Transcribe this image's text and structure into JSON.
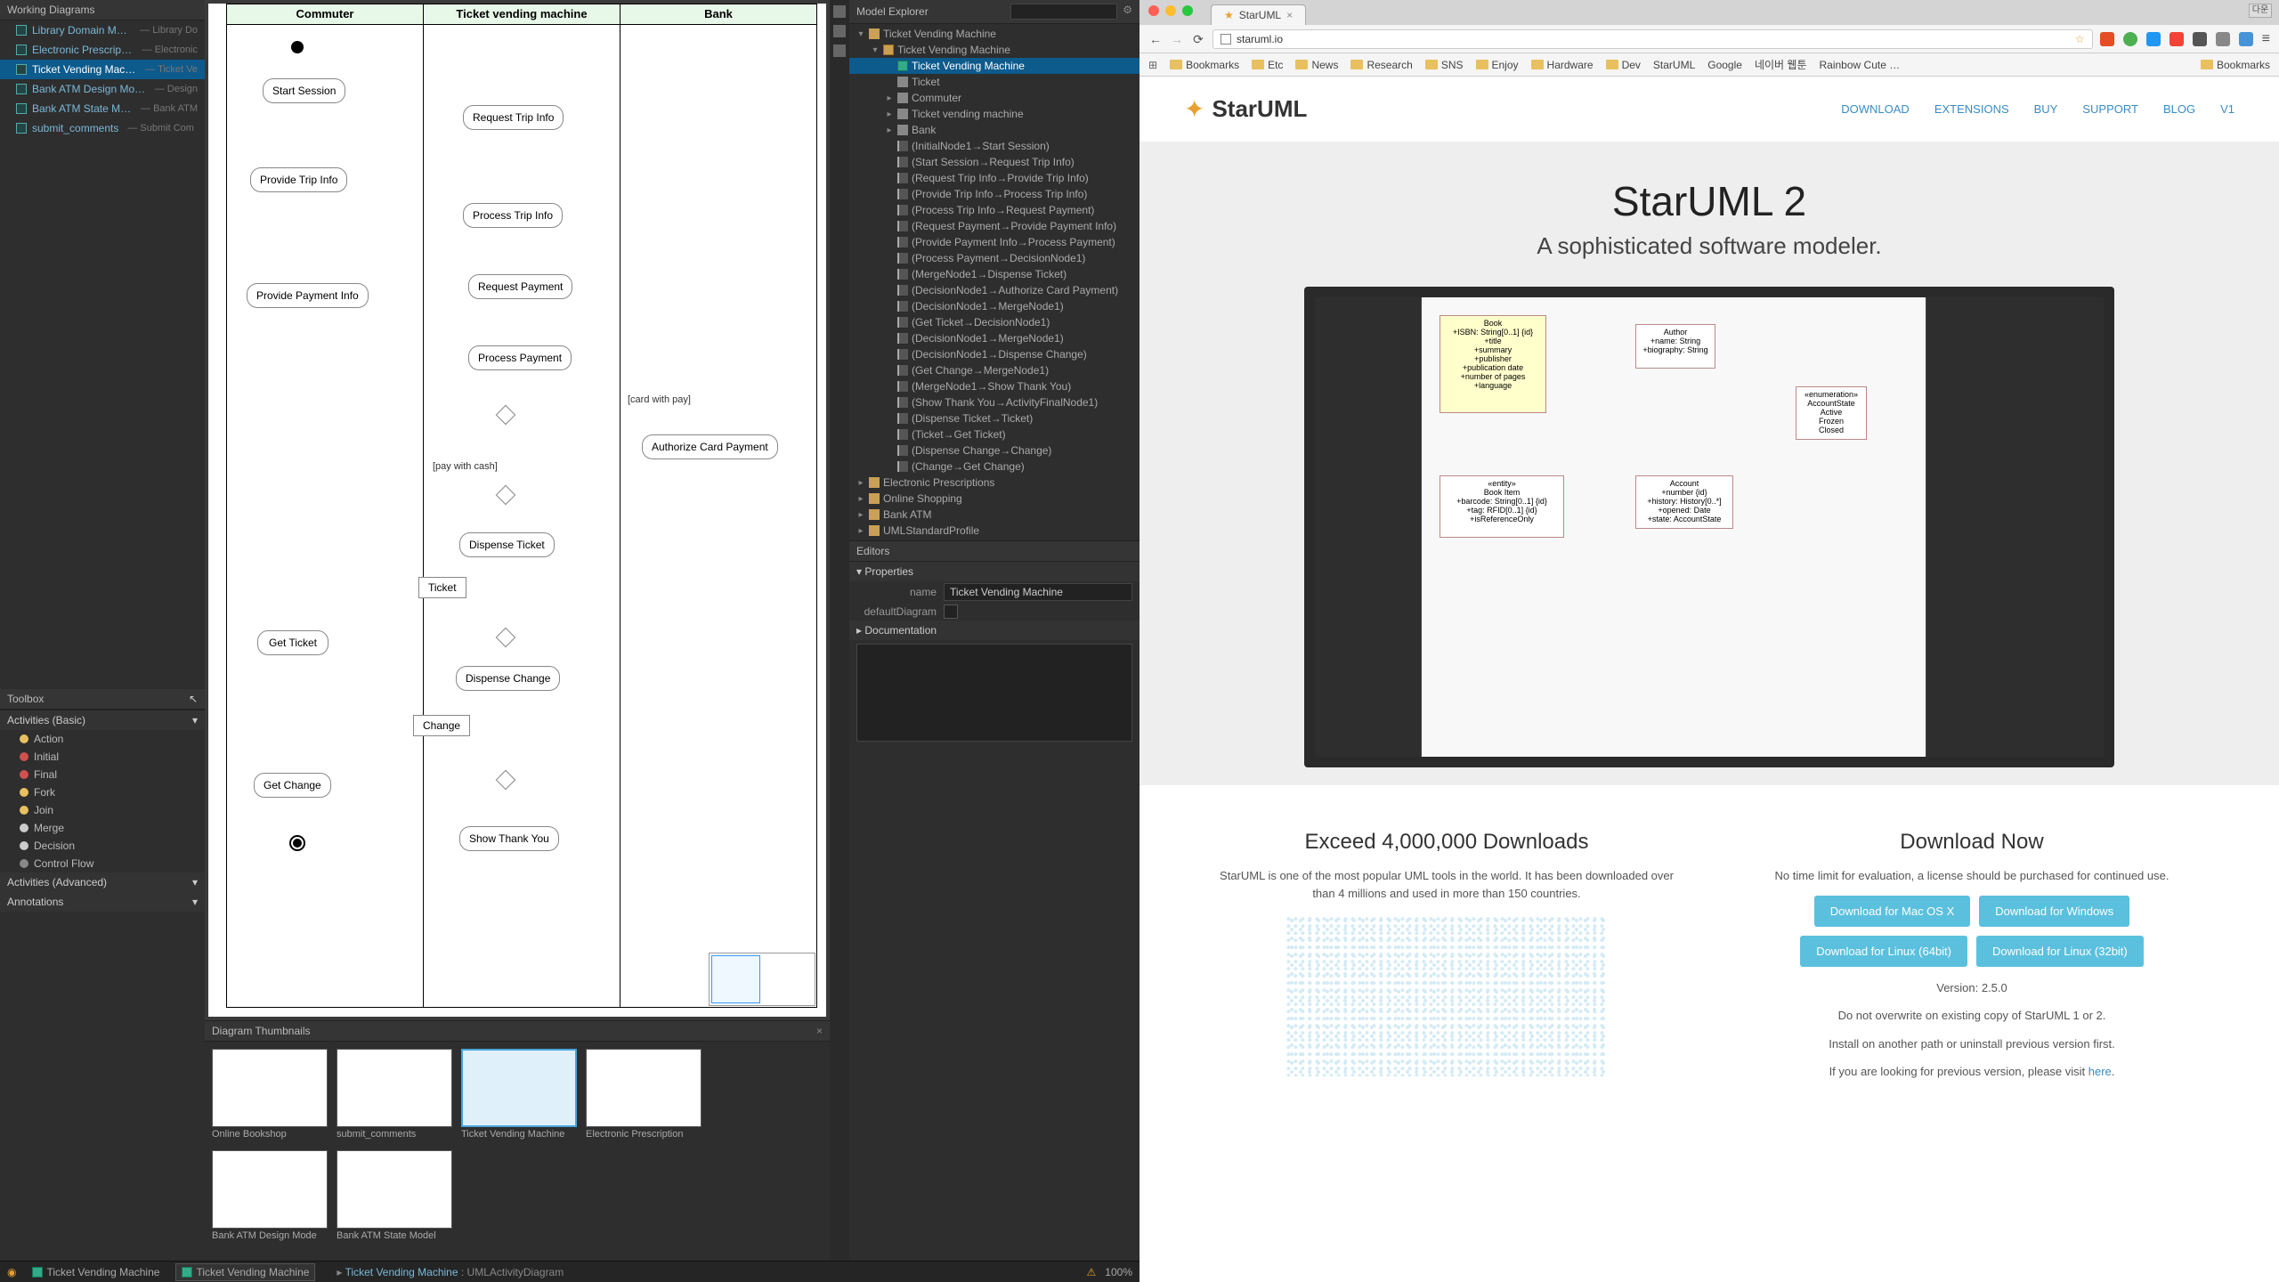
{
  "leftApp": {
    "workingDiagrams": {
      "title": "Working Diagrams",
      "items": [
        {
          "name": "Library Domain Model",
          "sub": "— Library Do"
        },
        {
          "name": "Electronic Prescriptions",
          "sub": "— Electronic"
        },
        {
          "name": "Ticket Vending Machine",
          "sub": "— Ticket Ve",
          "selected": true
        },
        {
          "name": "Bank ATM Design Model",
          "sub": "— Design"
        },
        {
          "name": "Bank ATM State Model",
          "sub": "— Bank ATM"
        },
        {
          "name": "submit_comments",
          "sub": "— Submit Com"
        }
      ]
    },
    "toolbox": {
      "title": "Toolbox",
      "cursor": "↖",
      "sections": [
        {
          "name": "Activities (Basic)",
          "items": [
            {
              "label": "Action",
              "color": "#e8c060"
            },
            {
              "label": "Initial",
              "color": "#d05050"
            },
            {
              "label": "Final",
              "color": "#d05050"
            },
            {
              "label": "Fork",
              "color": "#e8c060"
            },
            {
              "label": "Join",
              "color": "#e8c060"
            },
            {
              "label": "Merge",
              "color": "#ccc"
            },
            {
              "label": "Decision",
              "color": "#ccc"
            },
            {
              "label": "Control Flow",
              "color": "#888"
            }
          ]
        },
        {
          "name": "Activities (Advanced)",
          "items": []
        },
        {
          "name": "Annotations",
          "items": []
        }
      ]
    },
    "canvas": {
      "swimlanes": [
        "Commuter",
        "Ticket vending machine",
        "Bank"
      ],
      "nodes": {
        "start_session": "Start Session",
        "request_trip_info": "Request Trip Info",
        "provide_trip_info": "Provide Trip Info",
        "process_trip_info": "Process Trip Info",
        "provide_payment_info": "Provide Payment Info",
        "request_payment": "Request Payment",
        "process_payment": "Process Payment",
        "authorize_card": "Authorize Card Payment",
        "dispense_ticket": "Dispense Ticket",
        "ticket": "Ticket",
        "get_ticket": "Get Ticket",
        "dispense_change": "Dispense Change",
        "change": "Change",
        "get_change": "Get Change",
        "show_thank_you": "Show Thank You"
      },
      "guards": {
        "pay_cash": "[pay with cash]",
        "card_pay": "[card with pay]"
      }
    },
    "thumbnails": {
      "title": "Diagram Thumbnails",
      "items": [
        {
          "label": "Online Bookshop"
        },
        {
          "label": "submit_comments"
        },
        {
          "label": "Ticket Vending Machine",
          "selected": true
        },
        {
          "label": "Electronic Prescription"
        },
        {
          "label": "Bank ATM Design Mode"
        },
        {
          "label": "Bank ATM State Model"
        }
      ]
    },
    "modelExplorer": {
      "title": "Model Explorer",
      "searchPlaceholder": "",
      "tree": [
        {
          "d": 0,
          "t": "▾",
          "ico": "pkg",
          "label": "Ticket Vending Machine"
        },
        {
          "d": 1,
          "t": "▾",
          "ico": "model",
          "label": "Ticket Vending Machine"
        },
        {
          "d": 2,
          "t": "",
          "ico": "diag",
          "label": "Ticket Vending Machine",
          "selected": true
        },
        {
          "d": 2,
          "t": "",
          "ico": "part",
          "label": "Ticket"
        },
        {
          "d": 2,
          "t": "▸",
          "ico": "part",
          "label": "Commuter"
        },
        {
          "d": 2,
          "t": "▸",
          "ico": "part",
          "label": "Ticket vending machine"
        },
        {
          "d": 2,
          "t": "▸",
          "ico": "part",
          "label": "Bank"
        },
        {
          "d": 2,
          "t": "",
          "ico": "flow",
          "label": "(InitialNode1→Start Session)"
        },
        {
          "d": 2,
          "t": "",
          "ico": "flow",
          "label": "(Start Session→Request Trip Info)"
        },
        {
          "d": 2,
          "t": "",
          "ico": "flow",
          "label": "(Request Trip Info→Provide Trip Info)"
        },
        {
          "d": 2,
          "t": "",
          "ico": "flow",
          "label": "(Provide Trip Info→Process Trip Info)"
        },
        {
          "d": 2,
          "t": "",
          "ico": "flow",
          "label": "(Process Trip Info→Request Payment)"
        },
        {
          "d": 2,
          "t": "",
          "ico": "flow",
          "label": "(Request Payment→Provide Payment Info)"
        },
        {
          "d": 2,
          "t": "",
          "ico": "flow",
          "label": "(Provide Payment Info→Process Payment)"
        },
        {
          "d": 2,
          "t": "",
          "ico": "flow",
          "label": "(Process Payment→DecisionNode1)"
        },
        {
          "d": 2,
          "t": "",
          "ico": "flow",
          "label": "(MergeNode1→Dispense Ticket)"
        },
        {
          "d": 2,
          "t": "",
          "ico": "flow",
          "label": "(DecisionNode1→Authorize Card Payment)"
        },
        {
          "d": 2,
          "t": "",
          "ico": "flow",
          "label": "(DecisionNode1→MergeNode1)"
        },
        {
          "d": 2,
          "t": "",
          "ico": "flow",
          "label": "(Get Ticket→DecisionNode1)"
        },
        {
          "d": 2,
          "t": "",
          "ico": "flow",
          "label": "(DecisionNode1→MergeNode1)"
        },
        {
          "d": 2,
          "t": "",
          "ico": "flow",
          "label": "(DecisionNode1→Dispense Change)"
        },
        {
          "d": 2,
          "t": "",
          "ico": "flow",
          "label": "(Get Change→MergeNode1)"
        },
        {
          "d": 2,
          "t": "",
          "ico": "flow",
          "label": "(MergeNode1→Show Thank You)"
        },
        {
          "d": 2,
          "t": "",
          "ico": "flow",
          "label": "(Show Thank You→ActivityFinalNode1)"
        },
        {
          "d": 2,
          "t": "",
          "ico": "flow",
          "label": "(Dispense Ticket→Ticket)"
        },
        {
          "d": 2,
          "t": "",
          "ico": "flow",
          "label": "(Ticket→Get Ticket)"
        },
        {
          "d": 2,
          "t": "",
          "ico": "flow",
          "label": "(Dispense Change→Change)"
        },
        {
          "d": 2,
          "t": "",
          "ico": "flow",
          "label": "(Change→Get Change)"
        },
        {
          "d": 0,
          "t": "▸",
          "ico": "pkg",
          "label": "Electronic Prescriptions"
        },
        {
          "d": 0,
          "t": "▸",
          "ico": "pkg",
          "label": "Online Shopping"
        },
        {
          "d": 0,
          "t": "▸",
          "ico": "pkg",
          "label": "Bank ATM"
        },
        {
          "d": 0,
          "t": "▸",
          "ico": "pkg",
          "label": "UMLStandardProfile"
        }
      ]
    },
    "editors": {
      "title": "Editors",
      "properties": "Properties",
      "nameLabel": "name",
      "nameValue": "Ticket Vending Machine",
      "defaultDiagramLabel": "defaultDiagram",
      "documentation": "Documentation"
    },
    "statusbar": {
      "tabs": [
        {
          "label": "Ticket Vending Machine"
        },
        {
          "label": "Ticket Vending Machine",
          "active": true
        }
      ],
      "breadcrumb_link": "Ticket Vending Machine",
      "breadcrumb_type": ": UMLActivityDiagram",
      "zoom": "100%"
    }
  },
  "browser": {
    "tabTitle": "StarUML",
    "url": "staruml.io",
    "winLabel": "다운",
    "bookmarks": [
      "Bookmarks",
      "Etc",
      "News",
      "Research",
      "SNS",
      "Enjoy",
      "Hardware",
      "Dev",
      "StarUML",
      "Google",
      "네이버 웹툰",
      "Rainbow Cute …"
    ],
    "bmRight": "Bookmarks",
    "site": {
      "logo": "StarUML",
      "nav": [
        "DOWNLOAD",
        "EXTENSIONS",
        "BUY",
        "SUPPORT",
        "BLOG",
        "V1"
      ],
      "heroTitle": "StarUML 2",
      "heroSub": "A sophisticated software modeler.",
      "promo1": {
        "title": "Exceed 4,000,000 Downloads",
        "text": "StarUML is one of the most popular UML tools in the world. It has been downloaded over than 4 millions and used in more than 150 countries."
      },
      "promo2": {
        "title": "Download Now",
        "text": "No time limit for evaluation, a license should be purchased for continued use.",
        "buttons": [
          "Download for Mac OS X",
          "Download for Windows",
          "Download for Linux (64bit)",
          "Download for Linux (32bit)"
        ],
        "version": "Version: 2.5.0",
        "warn1": "Do not overwrite on existing copy of StarUML 1 or 2.",
        "warn2": "Install on another path or uninstall previous version first.",
        "info": "If you are looking for previous version, please visit ",
        "infoLink": "here"
      }
    }
  }
}
